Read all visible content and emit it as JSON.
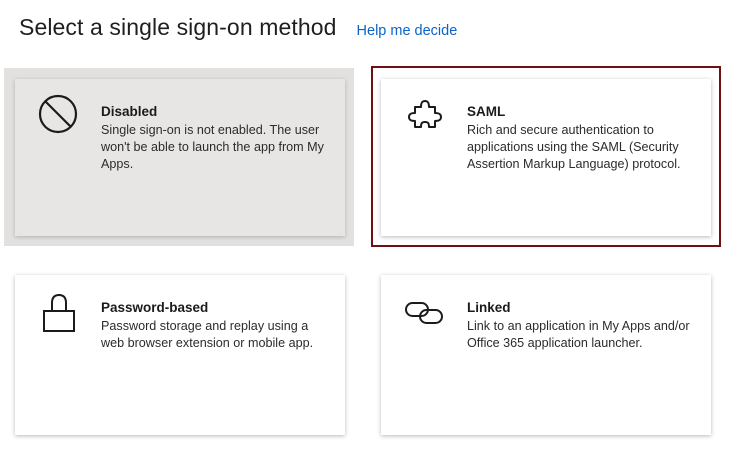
{
  "header": {
    "title": "Select a single sign-on method",
    "help_link": "Help me decide"
  },
  "tiles": [
    {
      "title": "Disabled",
      "description": "Single sign-on is not enabled. The user won't be able to launch the app from My Apps.",
      "icon": "disabled-icon"
    },
    {
      "title": "SAML",
      "description": "Rich and secure authentication to applications using the SAML (Security Assertion Markup Language) protocol.",
      "icon": "puzzle-piece-icon",
      "selected": true
    },
    {
      "title": "Password-based",
      "description": "Password storage and replay using a web browser extension or mobile app.",
      "icon": "lock-icon"
    },
    {
      "title": "Linked",
      "description": "Link to an application in My Apps and/or Office 365 application launcher.",
      "icon": "link-icon"
    }
  ],
  "colors": {
    "link": "#0a64c8",
    "selection_border": "#6e1010",
    "disabled_tile": "#e8e6e4"
  }
}
